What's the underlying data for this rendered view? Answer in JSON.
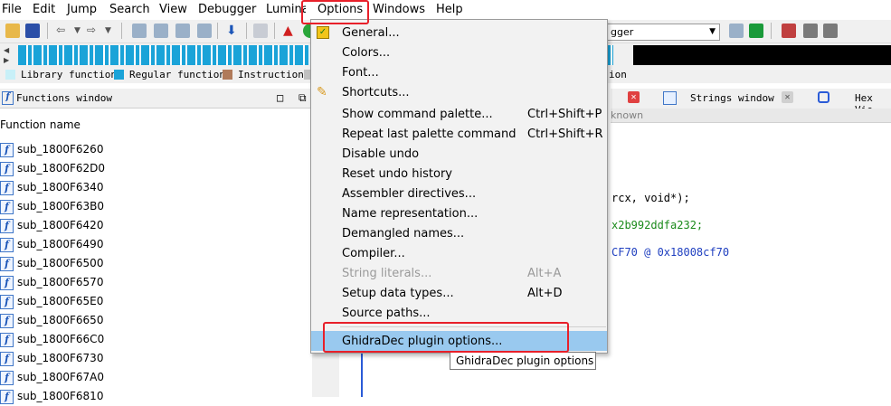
{
  "menubar": {
    "items": [
      "File",
      "Edit",
      "Jump",
      "Search",
      "View",
      "Debugger",
      "Lumina",
      "Options",
      "Windows",
      "Help"
    ]
  },
  "toolbar": {
    "debugger_value": "gger"
  },
  "legend": {
    "items": [
      {
        "label": "Library function",
        "color": "#c8f0f8"
      },
      {
        "label": "Regular function",
        "color": "#1aa3d8"
      },
      {
        "label": "Instruction",
        "color": "#b07a5a"
      }
    ],
    "tail_text": "ion"
  },
  "functions_window": {
    "title": "Functions window",
    "column_header": "Function name",
    "rows": [
      "sub_1800F6260",
      "sub_1800F62D0",
      "sub_1800F6340",
      "sub_1800F63B0",
      "sub_1800F6420",
      "sub_1800F6490",
      "sub_1800F6500",
      "sub_1800F6570",
      "sub_1800F65E0",
      "sub_1800F6650",
      "sub_1800F66C0",
      "sub_1800F6730",
      "sub_1800F67A0",
      "sub_1800F6810"
    ]
  },
  "tabs": {
    "strings": "Strings window",
    "hex": "Hex Vie"
  },
  "code": {
    "subheader": "known",
    "line1": "rcx, void*);",
    "line2": "x2b992ddfa232;",
    "line3": "CF70 @ 0x18008cf70"
  },
  "options_menu": {
    "items": [
      {
        "label": "General...",
        "shortcut": "",
        "disabled": false
      },
      {
        "label": "Colors...",
        "shortcut": "",
        "disabled": false
      },
      {
        "label": "Font...",
        "shortcut": "",
        "disabled": false
      },
      {
        "label": "Shortcuts...",
        "shortcut": "",
        "disabled": false
      },
      {
        "label": "Show command palette...",
        "shortcut": "Ctrl+Shift+P",
        "disabled": false
      },
      {
        "label": "Repeat last palette command",
        "shortcut": "Ctrl+Shift+R",
        "disabled": false
      },
      {
        "label": "Disable undo",
        "shortcut": "",
        "disabled": false
      },
      {
        "label": "Reset undo history",
        "shortcut": "",
        "disabled": false
      },
      {
        "label": "Assembler directives...",
        "shortcut": "",
        "disabled": false
      },
      {
        "label": "Name representation...",
        "shortcut": "",
        "disabled": false
      },
      {
        "label": "Demangled names...",
        "shortcut": "",
        "disabled": false
      },
      {
        "label": "Compiler...",
        "shortcut": "",
        "disabled": false
      },
      {
        "label": "String literals...",
        "shortcut": "Alt+A",
        "disabled": true
      },
      {
        "label": "Setup data types...",
        "shortcut": "Alt+D",
        "disabled": false
      },
      {
        "label": "Source paths...",
        "shortcut": "",
        "disabled": false
      }
    ],
    "plugin_item": "GhidraDec plugin options..."
  },
  "tooltip": "GhidraDec plugin options",
  "colors": {
    "highlight": "#99c9ef",
    "annotation_red": "#e8202a",
    "func_icon_blue": "#3f76c8"
  }
}
